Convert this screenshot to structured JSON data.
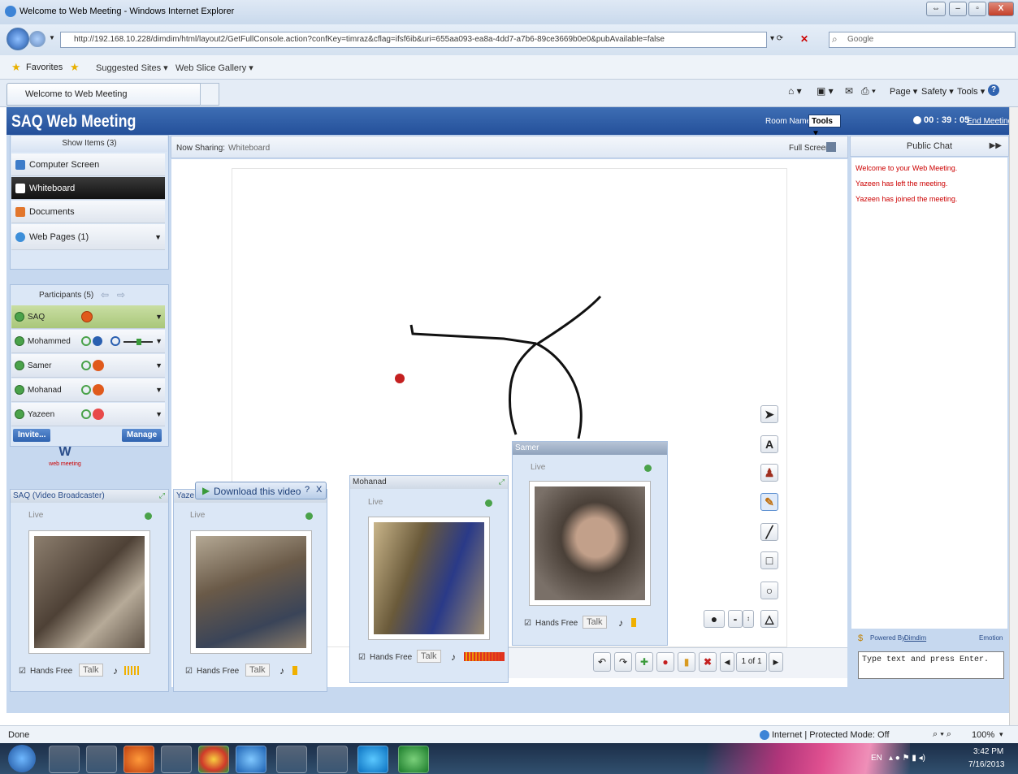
{
  "browser": {
    "window_title": "Welcome to Web Meeting - Windows Internet Explorer",
    "url": "http://192.168.10.228/dimdim/html/layout2/GetFullConsole.action?confKey=timraz&cflag=ifsf6ib&uri=655aa093-ea8a-4dd7-a7b6-89ce3669b0e0&pubAvailable=false",
    "search_placeholder": "Google",
    "favorites_label": "Favorites",
    "fav_items": [
      "Suggested Sites ▾",
      "Web Slice Gallery ▾"
    ],
    "tab_title": "Welcome to Web Meeting",
    "cmd_items": [
      "Page ▾",
      "Safety ▾",
      "Tools ▾"
    ],
    "status_text": "Done",
    "zone_text": "Internet | Protected Mode: Off",
    "zoom": "100%"
  },
  "app": {
    "title": "SAQ Web Meeting",
    "room_label": "Room Name :",
    "room_value": "Tools",
    "timer": "00 : 39 : 05",
    "end_meeting": "End Meeting"
  },
  "sidebar": {
    "show_items": "Show Items (3)",
    "items": [
      {
        "label": "Computer Screen",
        "color": "#3d7cc9"
      },
      {
        "label": "Whiteboard",
        "color": "#ffffff"
      },
      {
        "label": "Documents",
        "color": "#e2762c"
      },
      {
        "label": "Web Pages (1)",
        "color": "#3d8fd9"
      }
    ],
    "participants_header": "Participants (5)",
    "participants": [
      "SAQ",
      "Mohammed",
      "Samer",
      "Mohanad",
      "Yazeen"
    ],
    "invite": "Invite...",
    "manage": "Manage",
    "logo_text": "web meeting"
  },
  "main": {
    "now_sharing_label": "Now Sharing:",
    "now_sharing_value": "Whiteboard",
    "full_screen": "Full Screen",
    "page_indicator": "1 of 1"
  },
  "videos": [
    {
      "title": "SAQ (Video Broadcaster)",
      "live": "Live",
      "hands_free": "Hands Free",
      "talk": "Talk"
    },
    {
      "title": "Yaze",
      "live": "Live",
      "hands_free": "Hands Free",
      "talk": "Talk",
      "download": "Download this video"
    },
    {
      "title": "Mohanad",
      "live": "Live",
      "hands_free": "Hands Free",
      "talk": "Talk"
    },
    {
      "title": "Samer",
      "live": "Live",
      "hands_free": "Hands Free",
      "talk": "Talk"
    }
  ],
  "chat": {
    "header": "Public Chat",
    "messages": [
      "Welcome to your Web Meeting.",
      "Yazeen has left the meeting.",
      "Yazeen has joined the meeting."
    ],
    "powered_by": "Powered By",
    "powered_link": "Dimdim",
    "emotion": "Emotion",
    "input_placeholder": "Type text and press Enter."
  },
  "taskbar": {
    "lang": "EN",
    "time": "3:42 PM",
    "date": "7/16/2013"
  }
}
